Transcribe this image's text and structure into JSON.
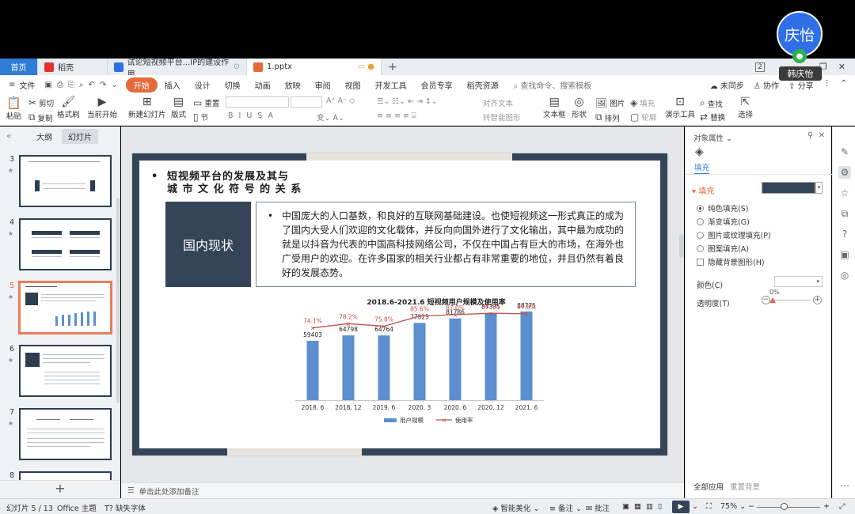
{
  "meeting": {
    "avatar_text": "庆怡",
    "name": "韩庆怡"
  },
  "tabs": {
    "home": "首页",
    "docer": "稻壳",
    "doc": "试论短视频平台...IP的建设作用",
    "active": "1.pptx",
    "badge": "2"
  },
  "menu": {
    "file": "文件",
    "items": [
      "开始",
      "插入",
      "设计",
      "切换",
      "动画",
      "放映",
      "审阅",
      "视图",
      "开发工具",
      "会员专享",
      "稻壳资源"
    ],
    "search_placeholder": "查找命令、搜索模板",
    "right": [
      "未同步",
      "协作",
      "分享"
    ]
  },
  "ribbon": {
    "paste": "粘贴",
    "cut": "剪切",
    "copy": "复制",
    "format_painter": "格式刷",
    "from_current": "当前开始",
    "new_slide": "新建幻灯片",
    "layout": "版式",
    "section": "节",
    "reset": "重置",
    "text_box": "文本框",
    "shape": "形状",
    "arrange": "排列",
    "outline": "轮廓",
    "picture": "图片",
    "fill": "填充",
    "present_tools": "演示工具",
    "find": "查找",
    "replace": "替换",
    "select": "选择",
    "align_text": "对齐文本",
    "to_smartart": "转智能图形"
  },
  "left_panel": {
    "tab_outline": "大纲",
    "tab_slides": "幻灯片",
    "slide_numbers": [
      "3",
      "4",
      "5",
      "6",
      "7",
      "8"
    ]
  },
  "slide": {
    "title_line1": "短视频平台的发展及其与",
    "title_line2": "城 市 文 化 符 号 的 关 系",
    "status_label": "国内现状",
    "body": "中国庞大的人口基数，和良好的互联网基础建设。也使短视频这一形式真正的成为了国内大受人们欢迎的文化载体，并反向向国外进行了文化输出，其中最为成功的就是以抖音为代表的中国高科技网络公司，不仅在中国占有巨大的市场，在海外也广受用户的欢迎。在许多国家的相关行业都占有非常重要的地位，并且仍然有着良好的发展态势。"
  },
  "chart_data": {
    "type": "bar",
    "title": "2018.6-2021.6 短视频用户规模及使用率",
    "categories": [
      "2018. 6",
      "2018. 12",
      "2019. 6",
      "2020. 3",
      "2020. 6",
      "2020. 12",
      "2021. 6"
    ],
    "series": [
      {
        "name": "用户规模",
        "type": "bar",
        "values": [
          59403,
          64798,
          64764,
          77325,
          81786,
          87335,
          88775
        ],
        "labels": [
          "59403",
          "64798",
          "64764",
          "77325",
          "81786",
          "87335",
          "88775"
        ],
        "color": "#5b8fd0"
      },
      {
        "name": "使用率",
        "type": "line",
        "values": [
          74.1,
          78.2,
          75.8,
          85.6,
          87.0,
          88.3,
          87.8
        ],
        "labels": [
          "74.1%",
          "78.2%",
          "75.8%",
          "85.6%",
          "87.0%",
          "88.3%",
          "87.8%"
        ],
        "color": "#c0504d"
      }
    ],
    "legend": "bottom",
    "grid": false
  },
  "right_panel": {
    "title": "对象属性",
    "fill_tab": "填充",
    "fill_section": "填充",
    "fill_color": "#344559",
    "options": [
      "纯色填充(S)",
      "渐变填充(G)",
      "图片或纹理填充(P)",
      "图案填充(A)"
    ],
    "hide_bg": "隐藏背景图形(H)",
    "color_label": "颜色(C)",
    "opacity_label": "透明度(T)",
    "opacity_value": "0%",
    "apply_all": "全部应用",
    "reset_bg": "重置背景"
  },
  "notes": {
    "placeholder": "单击此处添加备注"
  },
  "status": {
    "slide_index": "幻灯片 5 / 13",
    "theme": "Office 主题",
    "missing_font": "缺失字体",
    "smart_beautify": "智能美化",
    "notes": "备注",
    "comments": "批注",
    "zoom": "75%"
  }
}
